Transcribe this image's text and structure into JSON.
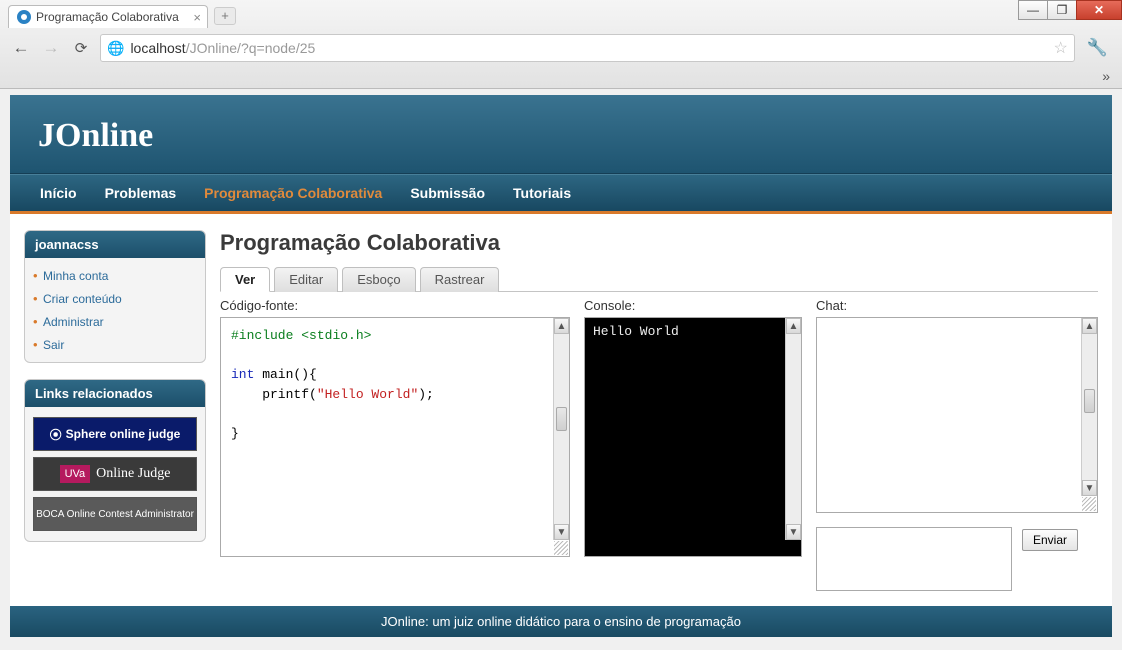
{
  "browser": {
    "tab_title": "Programação Colaborativa",
    "url_host": "localhost",
    "url_path": "/JOnline/?q=node/25"
  },
  "site": {
    "title": "JOnline",
    "nav": [
      "Início",
      "Problemas",
      "Programação Colaborativa",
      "Submissão",
      "Tutoriais"
    ],
    "nav_active_index": 2,
    "footer": "JOnline: um juiz online didático para o ensino de programação"
  },
  "sidebar": {
    "user_block_title": "joannacss",
    "user_links": [
      "Minha conta",
      "Criar conteúdo",
      "Administrar",
      "Sair"
    ],
    "related_title": "Links relacionados",
    "related": {
      "sphere": "Sphere online judge",
      "uva_badge": "UVa",
      "uva_text": "Online Judge",
      "boca": "BOCA Online Contest Administrator"
    }
  },
  "main": {
    "page_title": "Programação Colaborativa",
    "tabs": [
      "Ver",
      "Editar",
      "Esboço",
      "Rastrear"
    ],
    "tabs_active_index": 0,
    "labels": {
      "code": "Código-fonte:",
      "console": "Console:",
      "chat": "Chat:"
    },
    "code": {
      "include_kw": "#include",
      "include_lib": "<stdio.h>",
      "type_kw": "int",
      "main_sig": " main(){",
      "printf_pre": "    printf(",
      "printf_str": "\"Hello World\"",
      "printf_post": ");",
      "close": "}"
    },
    "console_output": "Hello World",
    "chat_messages": "",
    "chat_input_value": "",
    "send_label": "Enviar"
  }
}
